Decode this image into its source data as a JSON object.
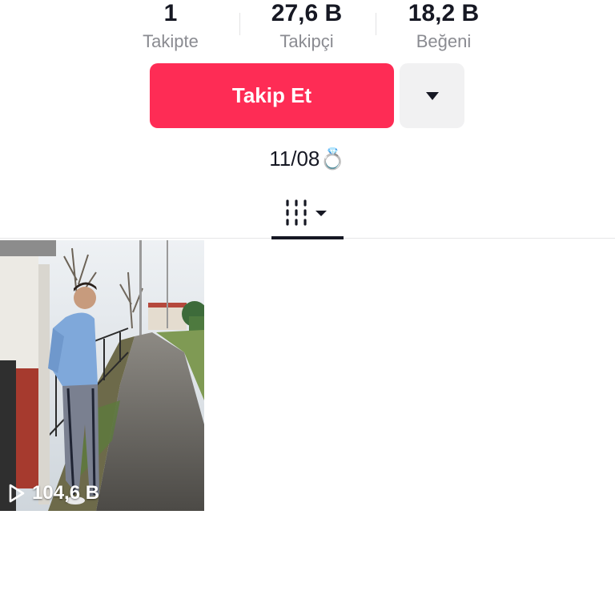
{
  "profile": {
    "stats": [
      {
        "value": "1",
        "label": "Takipte"
      },
      {
        "value": "27,6 B",
        "label": "Takipçi"
      },
      {
        "value": "18,2 B",
        "label": "Beğeni"
      }
    ],
    "follow_button_label": "Takip Et",
    "more_button_icon": "caret-down-icon",
    "bio": "11/08💍"
  },
  "tabs": {
    "active_icon": "videos-grid-icon",
    "dropdown_icon": "caret-down-icon"
  },
  "videos": [
    {
      "views": "104,6 B",
      "play_icon": "play-outline-icon"
    }
  ],
  "colors": {
    "accent": "#fe2c55",
    "text_primary": "#161823",
    "text_secondary": "#8a8b91",
    "secondary_button_bg": "#f1f1f2"
  }
}
